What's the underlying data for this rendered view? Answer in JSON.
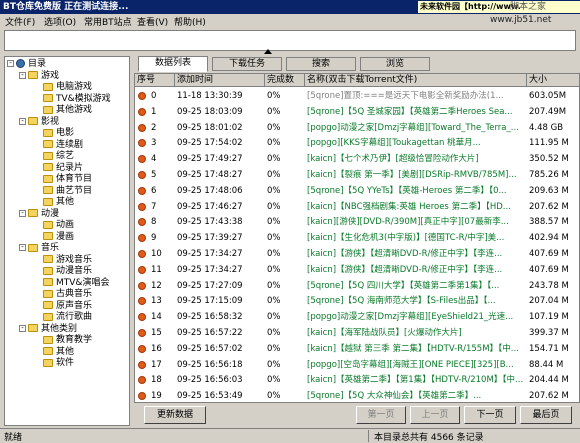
{
  "window": {
    "title": "BT仓库免费版 正在测试连接...",
    "ad_text": "未来软件园【http://www.",
    "watermark1": "脚本之家",
    "watermark2": "www.jb51.net"
  },
  "menu": {
    "items": [
      "文件(F)",
      "选项(O)",
      "常用BT站点",
      "查看(V)",
      "帮助(H)"
    ]
  },
  "tree": {
    "root": "目录",
    "categories": [
      {
        "label": "游戏",
        "children": [
          "电脑游戏",
          "TV&模拟游戏",
          "其他游戏"
        ]
      },
      {
        "label": "影视",
        "children": [
          "电影",
          "连续剧",
          "综艺",
          "纪录片",
          "体育节目",
          "曲艺节目",
          "其他"
        ]
      },
      {
        "label": "动漫",
        "children": [
          "动画",
          "漫画"
        ]
      },
      {
        "label": "音乐",
        "children": [
          "游戏音乐",
          "动漫音乐",
          "MTV&演唱会",
          "古典音乐",
          "原声音乐",
          "流行歌曲"
        ]
      },
      {
        "label": "其他类别",
        "children": [
          "教育教学",
          "其他",
          "软件"
        ]
      }
    ]
  },
  "tabs": [
    "数据列表",
    "下载任务",
    "搜索",
    "浏览"
  ],
  "columns": [
    "序号",
    "添加时间",
    "完成数",
    "名称(双击下载Torrent文件)",
    "大小"
  ],
  "rows": [
    {
      "no": "0",
      "time": "11-18 13:30:39",
      "done": "0%",
      "name": "[5qrone]置顶:===是远天下电影全新奖励办法(1...",
      "size": "603.05M"
    },
    {
      "no": "1",
      "time": "09-25 18:03:09",
      "done": "0%",
      "name": "[5qrone]【5Q 圣城家园】【英雄第二季Heroes Sea...",
      "size": "207.49M"
    },
    {
      "no": "2",
      "time": "09-25 18:01:02",
      "done": "0%",
      "name": "[popgo]动漫之家[Dmzj字幕组][Toward_The_Terra_...",
      "size": "4.48 GB"
    },
    {
      "no": "3",
      "time": "09-25 17:54:02",
      "done": "0%",
      "name": "[popgo][KKS字幕组][Toukagettan 桃華月...",
      "size": "111.95 M"
    },
    {
      "no": "4",
      "time": "09-25 17:49:27",
      "done": "0%",
      "name": "[kaicn]【七个术乃伊】[超级恰冒险动作大片]",
      "size": "350.52 M"
    },
    {
      "no": "5",
      "time": "09-25 17:48:27",
      "done": "0%",
      "name": "[kaicn]【裂痕 第一季】[美剧][DSRip-RMVB/785M]...",
      "size": "785.26 M"
    },
    {
      "no": "6",
      "time": "09-25 17:48:06",
      "done": "0%",
      "name": "[5qrone]【5Q YYeTs】【英雄-Heroes 第二季】【0...",
      "size": "209.63 M"
    },
    {
      "no": "7",
      "time": "09-25 17:46:27",
      "done": "0%",
      "name": "[kaicn]【NBC强档剧集:英雄 Heroes 第二季】【HD...",
      "size": "207.62 M"
    },
    {
      "no": "8",
      "time": "09-25 17:43:38",
      "done": "0%",
      "name": "[kaicn][游侠][DVD-R/390M][真正中字][07最新李...",
      "size": "388.57 M"
    },
    {
      "no": "9",
      "time": "09-25 17:39:27",
      "done": "0%",
      "name": "[kaicn]【生化危机3(中字版)】[德国TC-R/中字]美...",
      "size": "402.94 M"
    },
    {
      "no": "10",
      "time": "09-25 17:34:27",
      "done": "0%",
      "name": "[kaicn]【游侠】【超清晰DVD-R/修正中字】【李连...",
      "size": "407.69 M"
    },
    {
      "no": "11",
      "time": "09-25 17:34:27",
      "done": "0%",
      "name": "[kaicn]【游侠】【超清晰DVD-R/修正中字】【李连...",
      "size": "407.69 M"
    },
    {
      "no": "12",
      "time": "09-25 17:27:09",
      "done": "0%",
      "name": "[5qrone]【5Q 四川大学】【英雄第二季第1集】【...",
      "size": "243.78 M"
    },
    {
      "no": "13",
      "time": "09-25 17:15:09",
      "done": "0%",
      "name": "[5qrone]【5Q 海南师范大学】【S-Files出品】【...",
      "size": "207.04 M"
    },
    {
      "no": "14",
      "time": "09-25 16:58:32",
      "done": "0%",
      "name": "[popgo]动漫之家[Dmzj字幕组][EyeShield21_光速...",
      "size": "107.19 M"
    },
    {
      "no": "15",
      "time": "09-25 16:57:22",
      "done": "0%",
      "name": "[kaicn]【海军陆战队员】[火爆动作大片]",
      "size": "399.37 M"
    },
    {
      "no": "16",
      "time": "09-25 16:57:02",
      "done": "0%",
      "name": "[kaicn]【越狱 第三季 第二集】【HDTV-R/155M】【中...",
      "size": "154.71 M"
    },
    {
      "no": "17",
      "time": "09-25 16:56:18",
      "done": "0%",
      "name": "[popgo][空岛字幕组][海贼王][ONE PIECE][325][B...",
      "size": "88.44 M"
    },
    {
      "no": "18",
      "time": "09-25 16:56:03",
      "done": "0%",
      "name": "[kaicn]【英雄第二季】【第1集】【HDTV-R/210M】【中...",
      "size": "204.44 M"
    },
    {
      "no": "19",
      "time": "09-25 16:53:49",
      "done": "0%",
      "name": "[5qrone]【5Q 大众神仙会】【英雄第二季】...",
      "size": "207.62 M"
    }
  ],
  "buttons": {
    "refresh": "更新数据",
    "first": "第一页",
    "prev": "上一页",
    "next": "下一页",
    "last": "最后页"
  },
  "status": {
    "left": "就绪",
    "right": "本目录总共有 4566 条记录"
  }
}
